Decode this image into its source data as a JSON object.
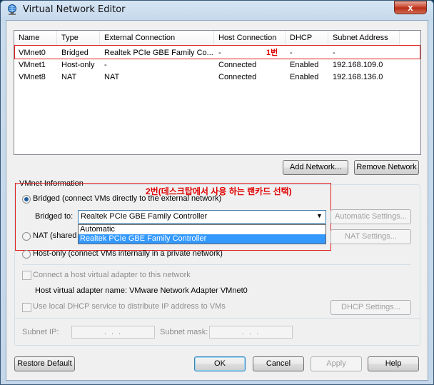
{
  "window": {
    "title": "Virtual Network Editor",
    "close_glyph": "x"
  },
  "table": {
    "columns": [
      "Name",
      "Type",
      "External Connection",
      "Host Connection",
      "DHCP",
      "Subnet Address"
    ],
    "rows": [
      [
        "VMnet0",
        "Bridged",
        "Realtek PCIe GBE Family Co...",
        "-",
        "-",
        "-"
      ],
      [
        "VMnet1",
        "Host-only",
        "-",
        "Connected",
        "Enabled",
        "192.168.109.0"
      ],
      [
        "VMnet8",
        "NAT",
        "NAT",
        "Connected",
        "Enabled",
        "192.168.136.0"
      ]
    ],
    "annotation_1": "1번"
  },
  "buttons": {
    "add_network": "Add Network...",
    "remove_network": "Remove Network",
    "automatic_settings": "Automatic Settings...",
    "nat_settings": "NAT Settings...",
    "dhcp_settings": "DHCP Settings...",
    "restore_default": "Restore Default",
    "ok": "OK",
    "cancel": "Cancel",
    "apply": "Apply",
    "help": "Help"
  },
  "vmnet_info": {
    "legend": "VMnet Information",
    "annotation_2": "2번(데스크탑에서 사용 하는 랜카드 선택)",
    "bridged_label": "Bridged (connect VMs directly to the external network)",
    "bridged_to_label": "Bridged to:",
    "bridged_to_value": "Realtek PCIe GBE Family Controller",
    "dropdown_options": [
      "Automatic",
      "Realtek PCIe GBE Family Controller"
    ],
    "nat_label": "NAT (shared",
    "hostonly_label": "Host-only (connect VMs internally in a private network)",
    "connect_adapter_label": "Connect a host virtual adapter to this network",
    "adapter_name_label": "Host virtual adapter name: VMware Network Adapter VMnet0",
    "dhcp_label": "Use local DHCP service to distribute IP address to VMs",
    "subnet_ip_label": "Subnet IP:",
    "subnet_mask_label": "Subnet mask:",
    "ip_placeholder": ". . .",
    "mask_placeholder": ". . ."
  },
  "colors": {
    "annotation": "#e00000",
    "selection": "#3399ff"
  }
}
